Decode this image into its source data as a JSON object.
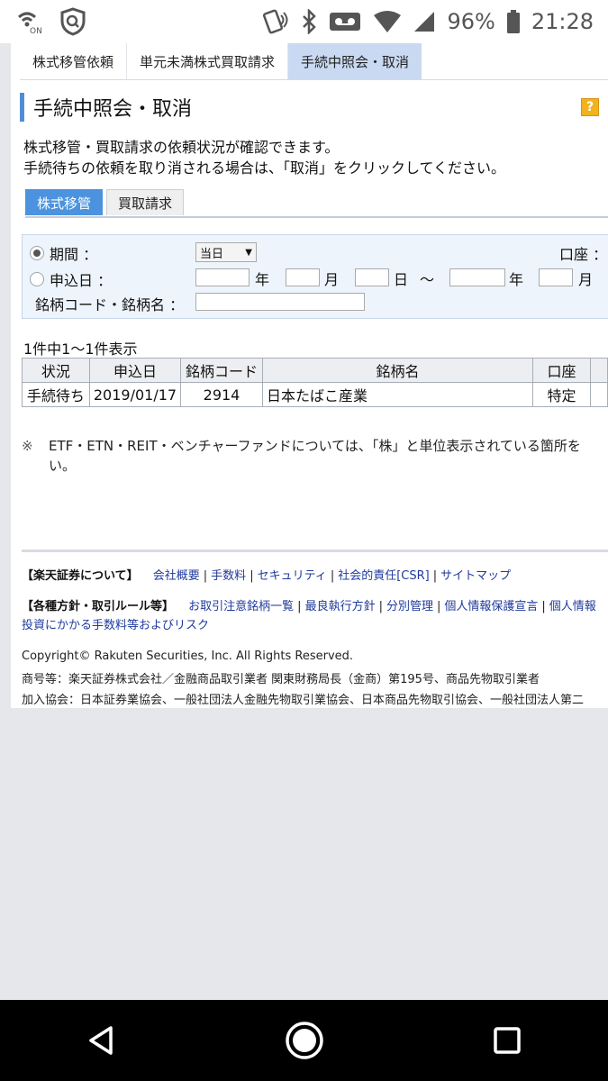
{
  "status_bar": {
    "battery_percent": "96%",
    "time": "21:28",
    "left_badge": "ON"
  },
  "top_tabs": [
    {
      "label": "株式移管依頼",
      "active": false
    },
    {
      "label": "単元未満株式買取請求",
      "active": false
    },
    {
      "label": "手続中照会・取消",
      "active": true
    }
  ],
  "page_title": "手続中照会・取消",
  "help_label": "?",
  "description": [
    "株式移管・買取請求の依頼状況が確認できます。",
    "手続待ちの依頼を取り消される場合は、「取消」をクリックしてください。"
  ],
  "sub_tabs": [
    {
      "label": "株式移管",
      "active": true
    },
    {
      "label": "買取請求",
      "active": false
    }
  ],
  "filter": {
    "period_label": "期間 ：",
    "period_value": "当日",
    "account_label": "口座 ：",
    "apply_date_label": "申込日 ：",
    "year_unit": "年",
    "month_unit": "月",
    "day_unit": "日",
    "range_sep": "～",
    "code_label": "銘柄コード・銘柄名 ："
  },
  "results_count": "1件中1～1件表示",
  "table": {
    "headers": [
      "状況",
      "申込日",
      "銘柄コード",
      "銘柄名",
      "口座"
    ],
    "rows": [
      [
        "手続待ち",
        "2019/01/17",
        "2914",
        "日本たばこ産業",
        "特定"
      ]
    ]
  },
  "note": {
    "mark": "※",
    "text": "ETF・ETN・REIT・ベンチャーファンドについては、「株」と単位表示されている箇所を",
    "text_continued": "い。"
  },
  "footer": {
    "about_heading": "【楽天証券について】",
    "about_links": [
      "会社概要",
      "手数料",
      "セキュリティ",
      "社会的責任[CSR]",
      "サイトマップ"
    ],
    "policy_heading": "【各種方針・取引ルール等】",
    "policy_links": [
      "お取引注意銘柄一覧",
      "最良執行方針",
      "分別管理",
      "個人情報保護宣言",
      "個人情報"
    ],
    "policy_link_extra": "投資にかかる手数料等およびリスク",
    "copyright": "Copyright© Rakuten Securities, Inc. All Rights Reserved.",
    "trade_name": "商号等：楽天証券株式会社／金融商品取引業者 関東財務局長（金商）第195号、商品先物取引業者",
    "associations": "加入協会：日本証券業協会、一般社団法人金融先物取引業協会、日本商品先物取引協会、一般社団法人第二"
  }
}
